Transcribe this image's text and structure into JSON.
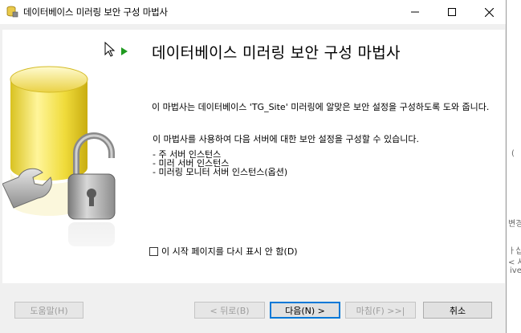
{
  "window": {
    "title": "데이터베이스 미러링 보안 구성 마법사"
  },
  "page": {
    "heading": "데이터베이스 미러링 보안 구성 마법사",
    "intro": "이 마법사는 데이터베이스 'TG_Site' 미러링에 알맞은 보안 설정을 구성하도록 도와 줍니다.",
    "usage": "이 마법사를 사용하여 다음 서버에 대한 보안 설정을 구성할 수 있습니다.",
    "bullets": [
      "- 주 서버 인스턴스",
      "- 미러 서버 인스턴스",
      "- 미러링 모니터 서버 인스턴스(옵션)"
    ],
    "dont_show_label": "이 시작 페이지를 다시 표시 안 함(D)",
    "dont_show_checked": false
  },
  "buttons": {
    "help": "도움말(H)",
    "back": "< 뒤로(B)",
    "next": "다음(N) >",
    "finish": "마침(F) >>|",
    "cancel": "취소"
  },
  "background_fragments": [
    "(",
    "변경",
    "ㅏ십",
    "< 사",
    "ive"
  ],
  "colors": {
    "accent": "#0078d7",
    "arrow": "#1f9a1f",
    "dialog_bg": "#f0f0f0"
  }
}
